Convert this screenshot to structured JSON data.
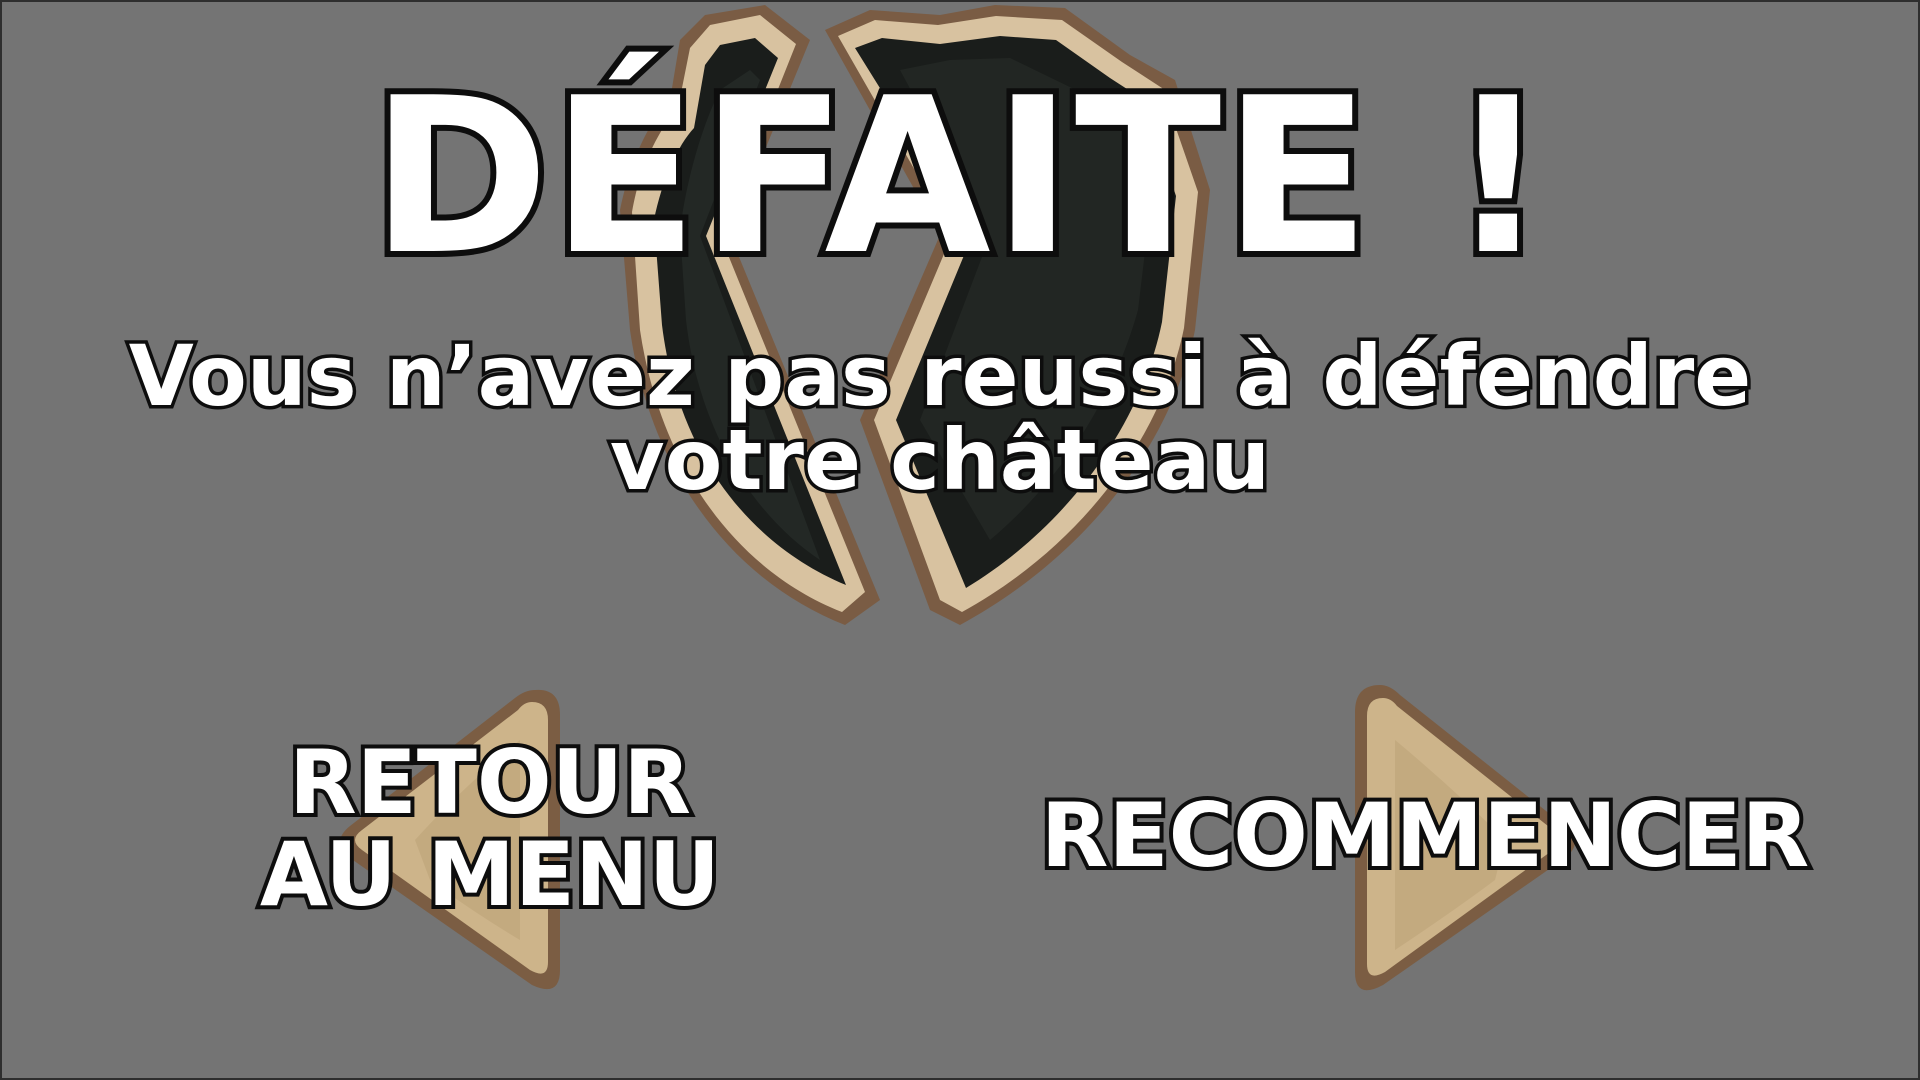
{
  "screen": {
    "title": "DÉFAITE !",
    "subtitle_line1": "Vous n’avez pas reussi à défendre",
    "subtitle_line2": "votre château",
    "background_color": "#747474"
  },
  "buttons": {
    "back_to_menu": {
      "label_line1": "RETOUR",
      "label_line2": "AU MENU",
      "icon": "left-arrow-icon"
    },
    "restart": {
      "label": "RECOMMENCER",
      "icon": "right-arrow-icon"
    }
  },
  "emblem": {
    "icon": "broken-shield-icon",
    "colors": {
      "shield_fill": "#1a1d1b",
      "shield_rim": "#d8c2a0",
      "shield_rim_shadow": "#7a5c44"
    }
  },
  "arrow_colors": {
    "fill": "#cdb48a",
    "edge": "#7b5d43"
  }
}
